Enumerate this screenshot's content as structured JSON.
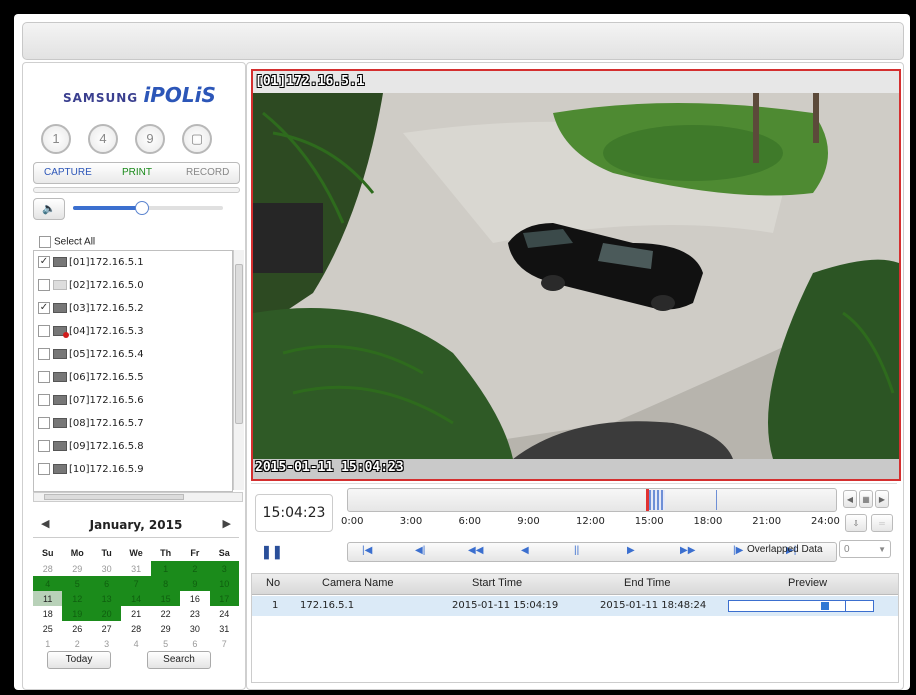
{
  "brand": {
    "samsung": "SAMSUNG",
    "ipolis": "iPOLiS"
  },
  "layout_buttons": [
    "1",
    "4",
    "9",
    "▢"
  ],
  "actions": {
    "capture": "CAPTURE",
    "print": "PRINT",
    "record": "RECORD"
  },
  "volume": {
    "level": 0.45
  },
  "select_all": "Select All",
  "cameras": [
    {
      "label": "[01]172.16.5.1",
      "checked": true,
      "state": "normal"
    },
    {
      "label": "[02]172.16.5.0",
      "checked": false,
      "state": "gray"
    },
    {
      "label": "[03]172.16.5.2",
      "checked": true,
      "state": "normal"
    },
    {
      "label": "[04]172.16.5.3",
      "checked": false,
      "state": "recording"
    },
    {
      "label": "[05]172.16.5.4",
      "checked": false,
      "state": "normal"
    },
    {
      "label": "[06]172.16.5.5",
      "checked": false,
      "state": "normal"
    },
    {
      "label": "[07]172.16.5.6",
      "checked": false,
      "state": "normal"
    },
    {
      "label": "[08]172.16.5.7",
      "checked": false,
      "state": "normal"
    },
    {
      "label": "[09]172.16.5.8",
      "checked": false,
      "state": "normal"
    },
    {
      "label": "[10]172.16.5.9",
      "checked": false,
      "state": "normal"
    }
  ],
  "calendar": {
    "month_label": "January, 2015",
    "weekdays": [
      "Su",
      "Mo",
      "Tu",
      "We",
      "Th",
      "Fr",
      "Sa"
    ],
    "weeks": [
      [
        {
          "d": "28",
          "t": "other"
        },
        {
          "d": "29",
          "t": "other"
        },
        {
          "d": "30",
          "t": "other"
        },
        {
          "d": "31",
          "t": "other"
        },
        {
          "d": "1",
          "t": "rec"
        },
        {
          "d": "2",
          "t": "rec"
        },
        {
          "d": "3",
          "t": "rec"
        }
      ],
      [
        {
          "d": "4",
          "t": "rec"
        },
        {
          "d": "5",
          "t": "rec"
        },
        {
          "d": "6",
          "t": "rec"
        },
        {
          "d": "7",
          "t": "rec"
        },
        {
          "d": "8",
          "t": "rec"
        },
        {
          "d": "9",
          "t": "rec"
        },
        {
          "d": "10",
          "t": "rec"
        }
      ],
      [
        {
          "d": "11",
          "t": "today"
        },
        {
          "d": "12",
          "t": "rec"
        },
        {
          "d": "13",
          "t": "rec"
        },
        {
          "d": "14",
          "t": "rec"
        },
        {
          "d": "15",
          "t": "rec"
        },
        {
          "d": "16",
          "t": ""
        },
        {
          "d": "17",
          "t": "rec"
        }
      ],
      [
        {
          "d": "18",
          "t": ""
        },
        {
          "d": "19",
          "t": "rec"
        },
        {
          "d": "20",
          "t": "rec"
        },
        {
          "d": "21",
          "t": ""
        },
        {
          "d": "22",
          "t": ""
        },
        {
          "d": "23",
          "t": ""
        },
        {
          "d": "24",
          "t": ""
        }
      ],
      [
        {
          "d": "25",
          "t": ""
        },
        {
          "d": "26",
          "t": ""
        },
        {
          "d": "27",
          "t": ""
        },
        {
          "d": "28",
          "t": ""
        },
        {
          "d": "29",
          "t": ""
        },
        {
          "d": "30",
          "t": ""
        },
        {
          "d": "31",
          "t": ""
        }
      ],
      [
        {
          "d": "1",
          "t": "other"
        },
        {
          "d": "2",
          "t": "other"
        },
        {
          "d": "3",
          "t": "other"
        },
        {
          "d": "4",
          "t": "other"
        },
        {
          "d": "5",
          "t": "other"
        },
        {
          "d": "6",
          "t": "other"
        },
        {
          "d": "7",
          "t": "other"
        }
      ]
    ],
    "today_button": "Today",
    "search_button": "Search"
  },
  "video": {
    "title": "[01]172.16.5.1",
    "timestamp": "2015-01-11 15:04:23"
  },
  "playback": {
    "current_time": "15:04:23",
    "ticks": [
      "0:00",
      "3:00",
      "6:00",
      "9:00",
      "12:00",
      "15:00",
      "18:00",
      "21:00",
      "24:00"
    ],
    "overlapped_label": "Overlapped Data",
    "overlapped_value": "0",
    "controls": [
      "|◀",
      "◀|",
      "◀◀",
      "◀",
      "||",
      "▶",
      "▶▶",
      "|▶",
      "▶|"
    ]
  },
  "results": {
    "columns": [
      "No",
      "Camera Name",
      "Start Time",
      "End Time",
      "Preview"
    ],
    "rows": [
      {
        "no": "1",
        "camera": "172.16.5.1",
        "start": "2015-01-11 15:04:19",
        "end": "2015-01-11 18:48:24"
      }
    ]
  }
}
